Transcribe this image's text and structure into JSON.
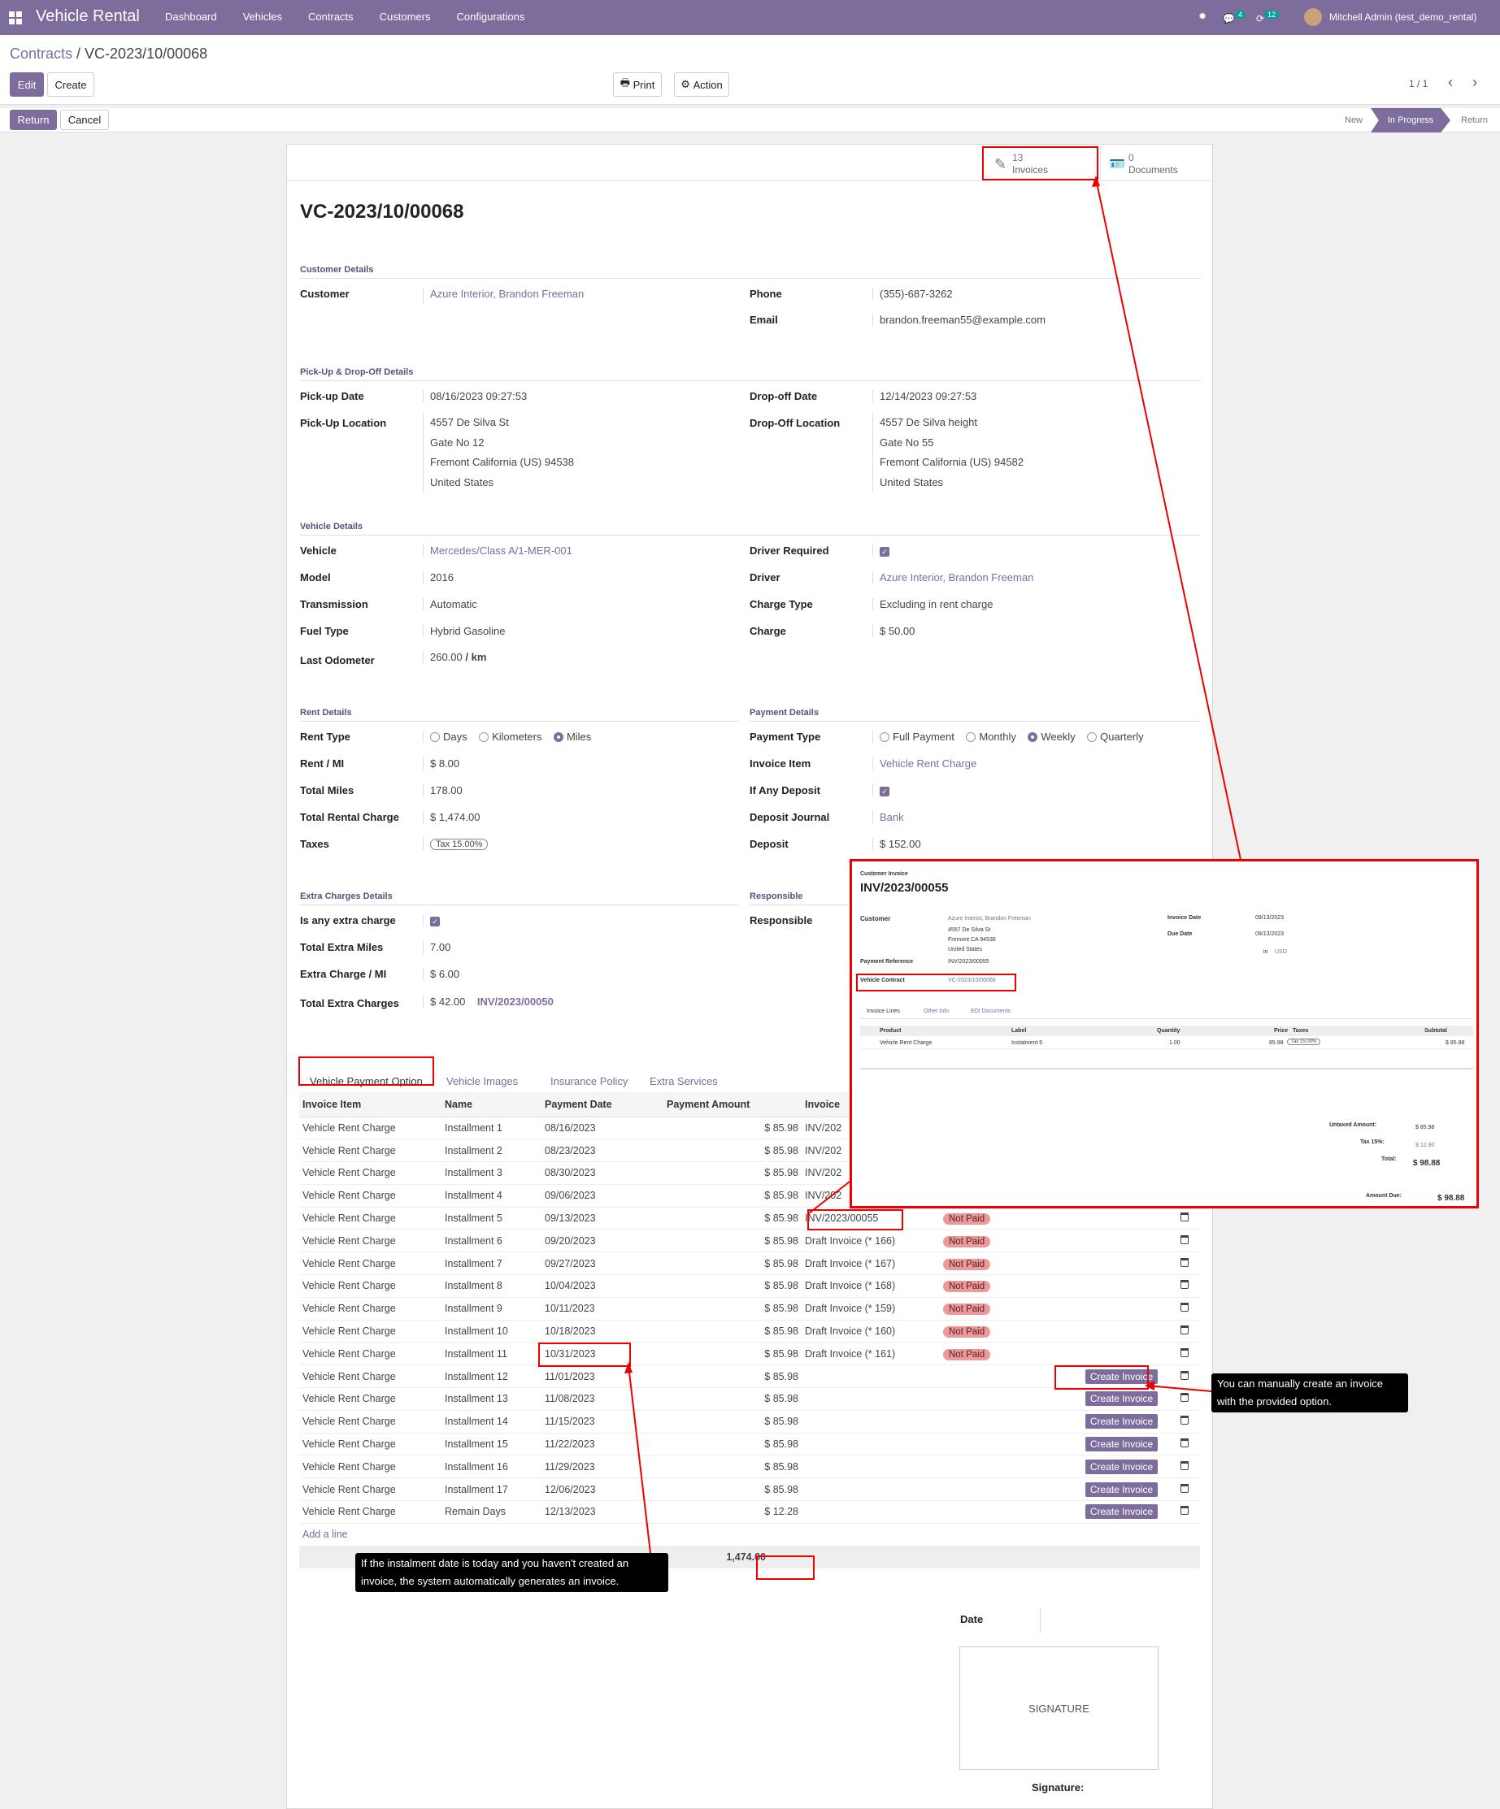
{
  "nav": {
    "brand": "Vehicle Rental",
    "menu": [
      "Dashboard",
      "Vehicles",
      "Contracts",
      "Customers",
      "Configurations"
    ],
    "messages_badge": "4",
    "activities_badge": "12",
    "user": "Mitchell Admin (test_demo_rental)"
  },
  "breadcrumb": {
    "parent": "Contracts",
    "sep": " / ",
    "current": "VC-2023/10/00068"
  },
  "controls": {
    "edit": "Edit",
    "create": "Create",
    "print": "Print",
    "action": "Action",
    "pager": "1 / 1",
    "return": "Return",
    "cancel": "Cancel"
  },
  "stages": [
    "New",
    "In Progress",
    "Return"
  ],
  "smart_buttons": {
    "invoices_count": "13",
    "invoices_label": "Invoices",
    "documents_count": "0",
    "documents_label": "Documents"
  },
  "title": "VC-2023/10/00068",
  "sections": {
    "customer": "Customer Details",
    "pickup": "Pick-Up & Drop-Off Details",
    "vehicle": "Vehicle Details",
    "rent": "Rent Details",
    "payment": "Payment Details",
    "extra": "Extra Charges Details",
    "responsible": "Responsible"
  },
  "customer": {
    "customer_label": "Customer",
    "customer": "Azure Interior, Brandon Freeman",
    "phone_label": "Phone",
    "phone": "(355)-687-3262",
    "email_label": "Email",
    "email": "brandon.freeman55@example.com"
  },
  "pickup": {
    "pickup_date_label": "Pick-up Date",
    "pickup_date": "08/16/2023 09:27:53",
    "dropoff_date_label": "Drop-off Date",
    "dropoff_date": "12/14/2023 09:27:53",
    "pickup_loc_label": "Pick-Up Location",
    "pickup_loc": [
      "4557 De Silva St",
      "Gate No 12",
      "Fremont  California (US)  94538",
      "United States"
    ],
    "dropoff_loc_label": "Drop-Off Location",
    "dropoff_loc": [
      "4557 De Silva height",
      "Gate No 55",
      "Fremont  California (US)  94582",
      "United States"
    ]
  },
  "vehicle": {
    "vehicle_label": "Vehicle",
    "vehicle": "Mercedes/Class A/1-MER-001",
    "model_label": "Model",
    "model": "2016",
    "transmission_label": "Transmission",
    "transmission": "Automatic",
    "fuel_label": "Fuel Type",
    "fuel": "Hybrid Gasoline",
    "odometer_label": "Last Odometer",
    "odometer": "260.00",
    "odometer_unit": "/ km",
    "driver_req_label": "Driver Required",
    "driver_label": "Driver",
    "driver": "Azure Interior, Brandon Freeman",
    "charge_type_label": "Charge Type",
    "charge_type": "Excluding in rent charge",
    "charge_label": "Charge",
    "charge": "$ 50.00"
  },
  "rent": {
    "type_label": "Rent Type",
    "types": [
      "Days",
      "Kilometers",
      "Miles"
    ],
    "rent_mi_label": "Rent / MI",
    "rent_mi": "$ 8.00",
    "total_miles_label": "Total Miles",
    "total_miles": "178.00",
    "total_charge_label": "Total Rental Charge",
    "total_charge": "$ 1,474.00",
    "taxes_label": "Taxes",
    "tax": "Tax 15.00%"
  },
  "payment": {
    "type_label": "Payment Type",
    "types": [
      "Full Payment",
      "Monthly",
      "Weekly",
      "Quarterly"
    ],
    "invoice_item_label": "Invoice Item",
    "invoice_item": "Vehicle Rent Charge",
    "deposit_flag_label": "If Any Deposit",
    "journal_label": "Deposit Journal",
    "journal": "Bank",
    "deposit_label": "Deposit",
    "deposit": "$ 152.00"
  },
  "extra": {
    "is_extra_label": "Is any extra charge",
    "miles_label": "Total Extra Miles",
    "miles": "7.00",
    "charge_mi_label": "Extra Charge / MI",
    "charge_mi": "$ 6.00",
    "total_label": "Total Extra Charges",
    "total": "$ 42.00",
    "invoice": "INV/2023/00050",
    "responsible_label": "Responsible"
  },
  "tabs": [
    "Vehicle Payment Option",
    "Vehicle Images",
    "Insurance Policy",
    "Extra Services"
  ],
  "lines": {
    "headers": [
      "Invoice Item",
      "Name",
      "Payment Date",
      "Payment Amount",
      "Invoice"
    ],
    "rows": [
      [
        "Vehicle Rent Charge",
        "Installment 1",
        "08/16/2023",
        "$ 85.98",
        "INV/202",
        ""
      ],
      [
        "Vehicle Rent Charge",
        "Installment 2",
        "08/23/2023",
        "$ 85.98",
        "INV/202",
        ""
      ],
      [
        "Vehicle Rent Charge",
        "Installment 3",
        "08/30/2023",
        "$ 85.98",
        "INV/202",
        ""
      ],
      [
        "Vehicle Rent Charge",
        "Installment 4",
        "09/06/2023",
        "$ 85.98",
        "INV/202",
        ""
      ],
      [
        "Vehicle Rent Charge",
        "Installment 5",
        "09/13/2023",
        "$ 85.98",
        "INV/2023/00055",
        "Not Paid"
      ],
      [
        "Vehicle Rent Charge",
        "Installment 6",
        "09/20/2023",
        "$ 85.98",
        "Draft Invoice (* 166)",
        "Not Paid"
      ],
      [
        "Vehicle Rent Charge",
        "Installment 7",
        "09/27/2023",
        "$ 85.98",
        "Draft Invoice (* 167)",
        "Not Paid"
      ],
      [
        "Vehicle Rent Charge",
        "Installment 8",
        "10/04/2023",
        "$ 85.98",
        "Draft Invoice (* 168)",
        "Not Paid"
      ],
      [
        "Vehicle Rent Charge",
        "Installment 9",
        "10/11/2023",
        "$ 85.98",
        "Draft Invoice (* 159)",
        "Not Paid"
      ],
      [
        "Vehicle Rent Charge",
        "Installment 10",
        "10/18/2023",
        "$ 85.98",
        "Draft Invoice (* 160)",
        "Not Paid"
      ],
      [
        "Vehicle Rent Charge",
        "Installment 11",
        "10/31/2023",
        "$ 85.98",
        "Draft Invoice (* 161)",
        "Not Paid"
      ],
      [
        "Vehicle Rent Charge",
        "Installment 12",
        "11/01/2023",
        "$ 85.98",
        "",
        "create"
      ],
      [
        "Vehicle Rent Charge",
        "Installment 13",
        "11/08/2023",
        "$ 85.98",
        "",
        "create"
      ],
      [
        "Vehicle Rent Charge",
        "Installment 14",
        "11/15/2023",
        "$ 85.98",
        "",
        "create"
      ],
      [
        "Vehicle Rent Charge",
        "Installment 15",
        "11/22/2023",
        "$ 85.98",
        "",
        "create"
      ],
      [
        "Vehicle Rent Charge",
        "Installment 16",
        "11/29/2023",
        "$ 85.98",
        "",
        "create"
      ],
      [
        "Vehicle Rent Charge",
        "Installment 17",
        "12/06/2023",
        "$ 85.98",
        "",
        "create"
      ],
      [
        "Vehicle Rent Charge",
        "Remain Days",
        "12/13/2023",
        "$ 12.28",
        "",
        "create"
      ]
    ],
    "create_invoice_label": "Create Invoice",
    "add_line": "Add a line",
    "total": "1,474.00"
  },
  "signature": {
    "date_label": "Date",
    "box": "SIGNATURE",
    "label": "Signature:"
  },
  "callouts": {
    "manual": "You can manually create an invoice with the provided option.",
    "auto": "If the instalment date is today and you haven't created an invoice, the system automatically generates an invoice."
  },
  "invoice_popup": {
    "kicker": "Customer Invoice",
    "number": "INV/2023/00055",
    "customer_label": "Customer",
    "customer": "Azure Interior, Brandon Freeman",
    "address": [
      "4557 De Silva St",
      "Fremont CA 94538",
      "United States"
    ],
    "payment_ref_label": "Payment Reference",
    "payment_ref": "INV/2023/00055",
    "contract_label": "Vehicle Contract",
    "contract": "VC-2023/10/00068",
    "invoice_date_label": "Invoice Date",
    "invoice_date": "09/13/2023",
    "due_date_label": "Due Date",
    "due_date": "09/13/2023",
    "currency_in": "in",
    "currency": "USD",
    "tabs": [
      "Invoice Lines",
      "Other Info",
      "EDI Documents"
    ],
    "headers": [
      "Product",
      "Label",
      "Quantity",
      "Price",
      "Taxes",
      "Subtotal"
    ],
    "line": [
      "Vehicle Rent Charge",
      "Instalment 5",
      "1.00",
      "85.98",
      "Tax 15.00%",
      "$ 85.98"
    ],
    "untaxed_label": "Untaxed Amount:",
    "untaxed": "$ 85.98",
    "tax_label": "Tax 15%:",
    "tax": "$ 12.90",
    "total_label": "Total:",
    "total": "$ 98.88",
    "due_label": "Amount Due:",
    "due": "$ 98.88"
  },
  "colors": {
    "brand": "#7c6d9c",
    "annotation": "#ee0000",
    "not_paid": "#ee9999"
  }
}
